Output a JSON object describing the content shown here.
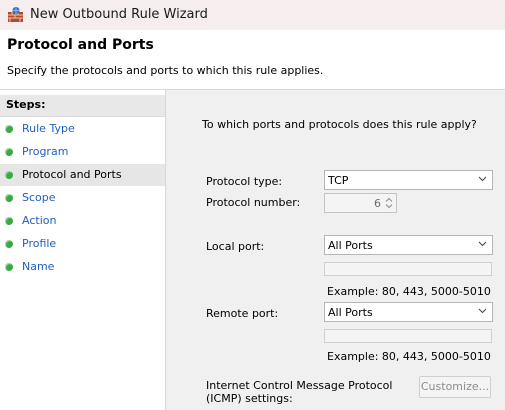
{
  "window": {
    "title": "New Outbound Rule Wizard",
    "icon": "firewall-rule-icon"
  },
  "header": {
    "title": "Protocol and Ports",
    "subtitle": "Specify the protocols and ports to which this rule applies."
  },
  "steps": {
    "heading": "Steps:",
    "items": [
      {
        "label": "Rule Type"
      },
      {
        "label": "Program"
      },
      {
        "label": "Protocol and Ports"
      },
      {
        "label": "Scope"
      },
      {
        "label": "Action"
      },
      {
        "label": "Profile"
      },
      {
        "label": "Name"
      }
    ],
    "active_index": 2,
    "bullet_color": "#3aa845",
    "link_color": "#1f5fbf"
  },
  "form": {
    "question": "To which ports and protocols does this rule apply?",
    "protocol_type": {
      "label": "Protocol type:",
      "value": "TCP"
    },
    "protocol_number": {
      "label": "Protocol number:",
      "value": "6"
    },
    "local_port": {
      "label": "Local port:",
      "value": "All Ports",
      "example": "Example: 80, 443, 5000-5010"
    },
    "remote_port": {
      "label": "Remote port:",
      "value": "All Ports",
      "example": "Example: 80, 443, 5000-5010"
    },
    "icmp": {
      "label_line1": "Internet Control Message Protocol",
      "label_line2": "(ICMP) settings:",
      "button": "Customize..."
    }
  }
}
